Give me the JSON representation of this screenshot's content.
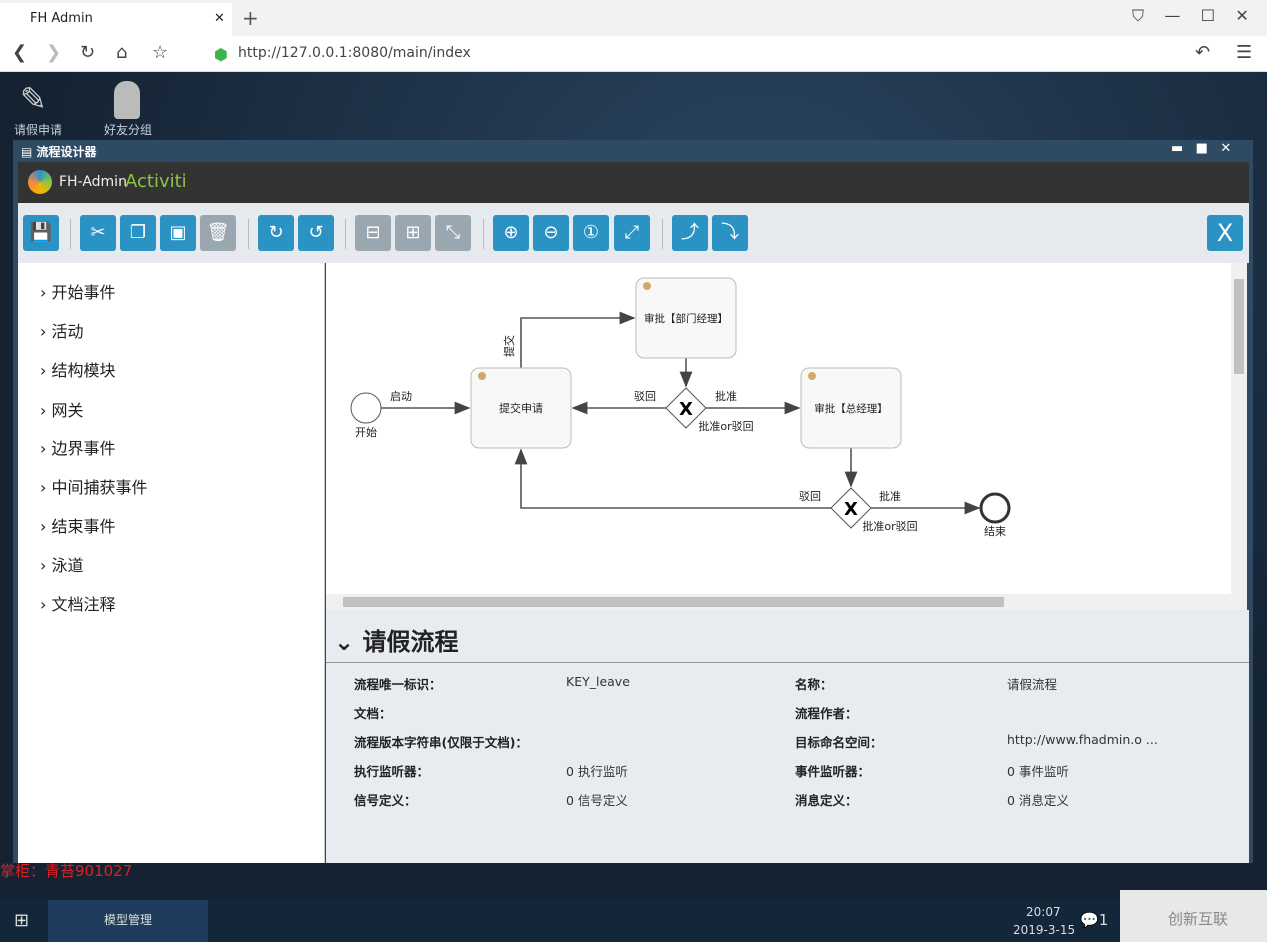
{
  "browser": {
    "tab_title": "FH Admin",
    "url": "http://127.0.0.1:8080/main/index"
  },
  "desktop": {
    "icons": [
      {
        "label": "请假申请",
        "icon": "edit-icon"
      },
      {
        "label": "好友分组",
        "icon": "person-icon"
      }
    ],
    "watermark": "掌柜：青苔901027"
  },
  "window": {
    "title": "流程设计器",
    "logo_text": "FH-Admin",
    "logo_accent": "Activiti"
  },
  "toolbar": {
    "buttons": [
      "save",
      "cut",
      "copy",
      "paste",
      "delete",
      "redo",
      "undo",
      "align-horizontal",
      "align-vertical",
      "same-size",
      "zoom-in",
      "zoom-out",
      "zoom-actual",
      "zoom-fit",
      "add-bendpoint",
      "remove-bendpoint"
    ],
    "close_label": "X"
  },
  "palette": {
    "items": [
      "开始事件",
      "活动",
      "结构模块",
      "网关",
      "边界事件",
      "中间捕获事件",
      "结束事件",
      "泳道",
      "文档注释"
    ]
  },
  "diagram": {
    "start_label": "开始",
    "end_label": "结束",
    "tasks": [
      "提交申请",
      "审批【部门经理】",
      "审批【总经理】"
    ],
    "flow_labels": {
      "start": "启动",
      "submit": "提交",
      "reject1": "驳回",
      "approve1": "批准",
      "gw1": "批准or驳回",
      "reject2": "驳回",
      "approve2": "批准",
      "gw2": "批准or驳回"
    }
  },
  "properties": {
    "title": "请假流程",
    "rows": [
      {
        "l1": "流程唯一标识：",
        "v1": "KEY_leave",
        "l2": "名称：",
        "v2": "请假流程"
      },
      {
        "l1": "文档：",
        "v1": "",
        "l2": "流程作者：",
        "v2": ""
      },
      {
        "l1": "流程版本字符串(仅限于文档)：",
        "v1": "",
        "l2": "目标命名空间：",
        "v2": "http://www.fhadmin.o ..."
      },
      {
        "l1": "执行监听器：",
        "v1": "0 执行监听",
        "l2": "事件监听器：",
        "v2": "0 事件监听"
      },
      {
        "l1": "信号定义：",
        "v1": "0 信号定义",
        "l2": "消息定义：",
        "v2": "0 消息定义"
      }
    ]
  },
  "taskbar": {
    "app": "模型管理",
    "time": "20:07",
    "date": "2019-3-15",
    "notif": "1",
    "brand": "创新互联"
  },
  "colors": {
    "button": "#2b93c4",
    "accent": "#8dc63f"
  }
}
